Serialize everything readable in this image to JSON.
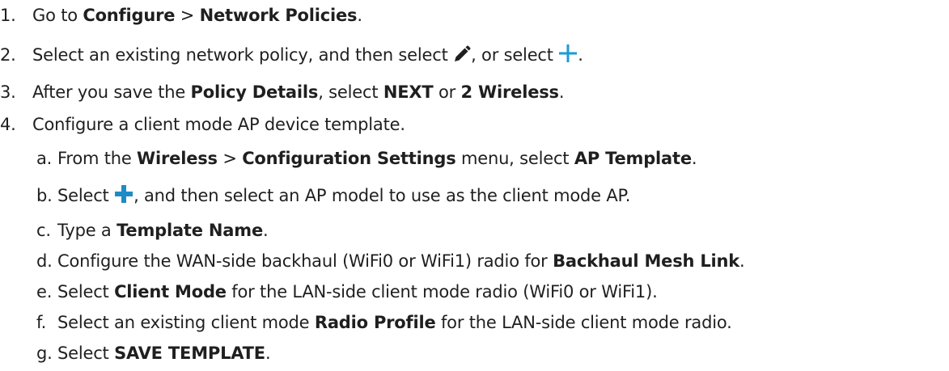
{
  "steps": [
    {
      "num": "1.",
      "p1": "Go to ",
      "b1": "Configure",
      "p2": " > ",
      "b2": "Network Policies",
      "p3": "."
    },
    {
      "num": "2.",
      "p1": "Select an existing network policy, and then select ",
      "icon1": "pencil-icon",
      "p2": ", or select ",
      "icon2": "plus-icon",
      "p3": "."
    },
    {
      "num": "3.",
      "p1": "After you save the ",
      "b1": "Policy Details",
      "p2": ", select ",
      "b2": "NEXT",
      "p3": " or ",
      "b3": "2 Wireless",
      "p4": "."
    },
    {
      "num": "4.",
      "p1": "Configure a client mode AP device template."
    }
  ],
  "substeps": [
    {
      "letter": "a.",
      "p1": "From the ",
      "b1": "Wireless",
      "p2": " > ",
      "b2": "Configuration Settings",
      "p3": " menu, select ",
      "b3": "AP Template",
      "p4": "."
    },
    {
      "letter": "b.",
      "p1": "Select ",
      "icon1": "plus-icon",
      "p2": ", and then select an AP model to use as the client mode AP."
    },
    {
      "letter": "c.",
      "p1": "Type a ",
      "b1": "Template Name",
      "p2": "."
    },
    {
      "letter": "d.",
      "p1": "Configure the WAN-side backhaul (WiFi0 or WiFi1) radio for ",
      "b1": "Backhaul Mesh Link",
      "p2": "."
    },
    {
      "letter": "e.",
      "p1": "Select ",
      "b1": "Client Mode",
      "p2": " for the LAN-side client mode radio (WiFi0 or WiFi1)."
    },
    {
      "letter": "f.",
      "p1": "Select an existing client mode ",
      "b1": "Radio Profile",
      "p2": " for the LAN-side client mode radio."
    },
    {
      "letter": "g.",
      "p1": "Select ",
      "b1": "SAVE TEMPLATE",
      "p2": "."
    }
  ],
  "colors": {
    "text": "#1f1f1f",
    "pencil_icon": "#1f1f1f",
    "plus_icon": "#1a9bd7",
    "plus_icon_bold": "#1f8bc6"
  }
}
